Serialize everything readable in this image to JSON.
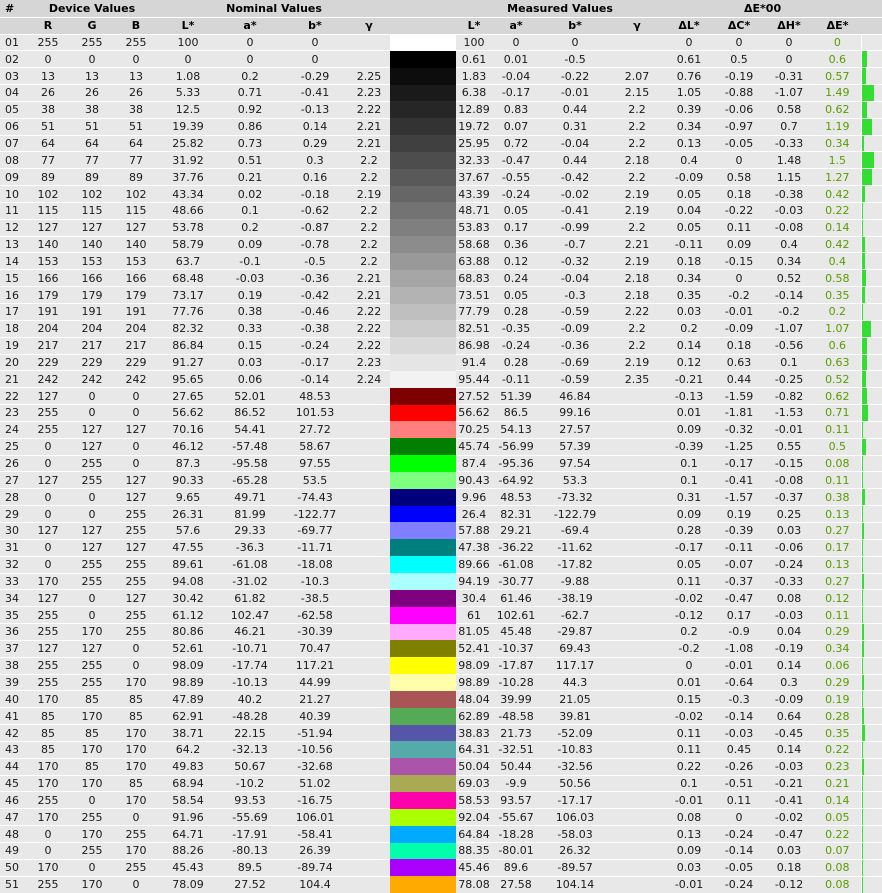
{
  "header": {
    "num": "#",
    "device": "Device Values",
    "nominal": "Nominal Values",
    "measured": "Measured Values",
    "de00": "ΔE*00"
  },
  "columns": {
    "r": "R",
    "g": "G",
    "b": "B",
    "l_star": "L*",
    "a_star": "a*",
    "b_star": "b*",
    "gamma": "γ",
    "d_l": "ΔL*",
    "d_c": "ΔC*",
    "d_h": "ΔH*",
    "d_e": "ΔE*"
  },
  "colors": {
    "header_bg": "#d6d6d6",
    "row_bg": "#e8e8e8",
    "separator": "#ffffff",
    "text": "#1a1a1a",
    "delta_e_text": "#5a9b00",
    "bar_green": "#33dd33"
  },
  "rows": [
    {
      "n": "01",
      "rgb": [
        255,
        255,
        255
      ],
      "nominal": [
        "100",
        "0",
        "0",
        ""
      ],
      "measured": [
        "100",
        "0",
        "0",
        ""
      ],
      "delta": [
        "0",
        "0",
        "0"
      ],
      "de": "0"
    },
    {
      "n": "02",
      "rgb": [
        0,
        0,
        0
      ],
      "nominal": [
        "0",
        "0",
        "0",
        ""
      ],
      "measured": [
        "0.61",
        "0.01",
        "-0.5",
        ""
      ],
      "delta": [
        "0.61",
        "0.5",
        "0"
      ],
      "de": "0.6"
    },
    {
      "n": "03",
      "rgb": [
        13,
        13,
        13
      ],
      "nominal": [
        "1.08",
        "0.2",
        "-0.29",
        "2.25"
      ],
      "measured": [
        "1.83",
        "-0.04",
        "-0.22",
        "2.07"
      ],
      "delta": [
        "0.76",
        "-0.19",
        "-0.31"
      ],
      "de": "0.57"
    },
    {
      "n": "04",
      "rgb": [
        26,
        26,
        26
      ],
      "nominal": [
        "5.33",
        "0.71",
        "-0.41",
        "2.23"
      ],
      "measured": [
        "6.38",
        "-0.17",
        "-0.01",
        "2.15"
      ],
      "delta": [
        "1.05",
        "-0.88",
        "-1.07"
      ],
      "de": "1.49"
    },
    {
      "n": "05",
      "rgb": [
        38,
        38,
        38
      ],
      "nominal": [
        "12.5",
        "0.92",
        "-0.13",
        "2.22"
      ],
      "measured": [
        "12.89",
        "0.83",
        "0.44",
        "2.2"
      ],
      "delta": [
        "0.39",
        "-0.06",
        "0.58"
      ],
      "de": "0.62"
    },
    {
      "n": "06",
      "rgb": [
        51,
        51,
        51
      ],
      "nominal": [
        "19.39",
        "0.86",
        "0.14",
        "2.21"
      ],
      "measured": [
        "19.72",
        "0.07",
        "0.31",
        "2.2"
      ],
      "delta": [
        "0.34",
        "-0.97",
        "0.7"
      ],
      "de": "1.19"
    },
    {
      "n": "07",
      "rgb": [
        64,
        64,
        64
      ],
      "nominal": [
        "25.82",
        "0.73",
        "0.29",
        "2.21"
      ],
      "measured": [
        "25.95",
        "0.72",
        "-0.04",
        "2.2"
      ],
      "delta": [
        "0.13",
        "-0.05",
        "-0.33"
      ],
      "de": "0.34"
    },
    {
      "n": "08",
      "rgb": [
        77,
        77,
        77
      ],
      "nominal": [
        "31.92",
        "0.51",
        "0.3",
        "2.2"
      ],
      "measured": [
        "32.33",
        "-0.47",
        "0.44",
        "2.18"
      ],
      "delta": [
        "0.4",
        "0",
        "1.48"
      ],
      "de": "1.5"
    },
    {
      "n": "09",
      "rgb": [
        89,
        89,
        89
      ],
      "nominal": [
        "37.76",
        "0.21",
        "0.16",
        "2.2"
      ],
      "measured": [
        "37.67",
        "-0.55",
        "-0.42",
        "2.2"
      ],
      "delta": [
        "-0.09",
        "0.58",
        "1.15"
      ],
      "de": "1.27"
    },
    {
      "n": "10",
      "rgb": [
        102,
        102,
        102
      ],
      "nominal": [
        "43.34",
        "0.02",
        "-0.18",
        "2.19"
      ],
      "measured": [
        "43.39",
        "-0.24",
        "-0.02",
        "2.19"
      ],
      "delta": [
        "0.05",
        "0.18",
        "-0.38"
      ],
      "de": "0.42"
    },
    {
      "n": "11",
      "rgb": [
        115,
        115,
        115
      ],
      "nominal": [
        "48.66",
        "0.1",
        "-0.62",
        "2.2"
      ],
      "measured": [
        "48.71",
        "0.05",
        "-0.41",
        "2.19"
      ],
      "delta": [
        "0.04",
        "-0.22",
        "-0.03"
      ],
      "de": "0.22"
    },
    {
      "n": "12",
      "rgb": [
        127,
        127,
        127
      ],
      "nominal": [
        "53.78",
        "0.2",
        "-0.87",
        "2.2"
      ],
      "measured": [
        "53.83",
        "0.17",
        "-0.99",
        "2.2"
      ],
      "delta": [
        "0.05",
        "0.11",
        "-0.08"
      ],
      "de": "0.14"
    },
    {
      "n": "13",
      "rgb": [
        140,
        140,
        140
      ],
      "nominal": [
        "58.79",
        "0.09",
        "-0.78",
        "2.2"
      ],
      "measured": [
        "58.68",
        "0.36",
        "-0.7",
        "2.21"
      ],
      "delta": [
        "-0.11",
        "0.09",
        "0.4"
      ],
      "de": "0.42"
    },
    {
      "n": "14",
      "rgb": [
        153,
        153,
        153
      ],
      "nominal": [
        "63.7",
        "-0.1",
        "-0.5",
        "2.2"
      ],
      "measured": [
        "63.88",
        "0.12",
        "-0.32",
        "2.19"
      ],
      "delta": [
        "0.18",
        "-0.15",
        "0.34"
      ],
      "de": "0.4"
    },
    {
      "n": "15",
      "rgb": [
        166,
        166,
        166
      ],
      "nominal": [
        "68.48",
        "-0.03",
        "-0.36",
        "2.21"
      ],
      "measured": [
        "68.83",
        "0.24",
        "-0.04",
        "2.18"
      ],
      "delta": [
        "0.34",
        "0",
        "0.52"
      ],
      "de": "0.58"
    },
    {
      "n": "16",
      "rgb": [
        179,
        179,
        179
      ],
      "nominal": [
        "73.17",
        "0.19",
        "-0.42",
        "2.21"
      ],
      "measured": [
        "73.51",
        "0.05",
        "-0.3",
        "2.18"
      ],
      "delta": [
        "0.35",
        "-0.2",
        "-0.14"
      ],
      "de": "0.35"
    },
    {
      "n": "17",
      "rgb": [
        191,
        191,
        191
      ],
      "nominal": [
        "77.76",
        "0.38",
        "-0.46",
        "2.22"
      ],
      "measured": [
        "77.79",
        "0.28",
        "-0.59",
        "2.22"
      ],
      "delta": [
        "0.03",
        "-0.01",
        "-0.2"
      ],
      "de": "0.2"
    },
    {
      "n": "18",
      "rgb": [
        204,
        204,
        204
      ],
      "nominal": [
        "82.32",
        "0.33",
        "-0.38",
        "2.22"
      ],
      "measured": [
        "82.51",
        "-0.35",
        "-0.09",
        "2.2"
      ],
      "delta": [
        "0.2",
        "-0.09",
        "-1.07"
      ],
      "de": "1.07"
    },
    {
      "n": "19",
      "rgb": [
        217,
        217,
        217
      ],
      "nominal": [
        "86.84",
        "0.15",
        "-0.24",
        "2.22"
      ],
      "measured": [
        "86.98",
        "-0.24",
        "-0.36",
        "2.2"
      ],
      "delta": [
        "0.14",
        "0.18",
        "-0.56"
      ],
      "de": "0.6"
    },
    {
      "n": "20",
      "rgb": [
        229,
        229,
        229
      ],
      "nominal": [
        "91.27",
        "0.03",
        "-0.17",
        "2.23"
      ],
      "measured": [
        "91.4",
        "0.28",
        "-0.69",
        "2.19"
      ],
      "delta": [
        "0.12",
        "0.63",
        "0.1"
      ],
      "de": "0.63"
    },
    {
      "n": "21",
      "rgb": [
        242,
        242,
        242
      ],
      "nominal": [
        "95.65",
        "0.06",
        "-0.14",
        "2.24"
      ],
      "measured": [
        "95.44",
        "-0.11",
        "-0.59",
        "2.35"
      ],
      "delta": [
        "-0.21",
        "0.44",
        "-0.25"
      ],
      "de": "0.52"
    },
    {
      "n": "22",
      "rgb": [
        127,
        0,
        0
      ],
      "nominal": [
        "27.65",
        "52.01",
        "48.53",
        ""
      ],
      "measured": [
        "27.52",
        "51.39",
        "46.84",
        ""
      ],
      "delta": [
        "-0.13",
        "-1.59",
        "-0.82"
      ],
      "de": "0.62"
    },
    {
      "n": "23",
      "rgb": [
        255,
        0,
        0
      ],
      "nominal": [
        "56.62",
        "86.52",
        "101.53",
        ""
      ],
      "measured": [
        "56.62",
        "86.5",
        "99.16",
        ""
      ],
      "delta": [
        "0.01",
        "-1.81",
        "-1.53"
      ],
      "de": "0.71"
    },
    {
      "n": "24",
      "rgb": [
        255,
        127,
        127
      ],
      "nominal": [
        "70.16",
        "54.41",
        "27.72",
        ""
      ],
      "measured": [
        "70.25",
        "54.13",
        "27.57",
        ""
      ],
      "delta": [
        "0.09",
        "-0.32",
        "-0.01"
      ],
      "de": "0.11"
    },
    {
      "n": "25",
      "rgb": [
        0,
        127,
        0
      ],
      "nominal": [
        "46.12",
        "-57.48",
        "58.67",
        ""
      ],
      "measured": [
        "45.74",
        "-56.99",
        "57.39",
        ""
      ],
      "delta": [
        "-0.39",
        "-1.25",
        "0.55"
      ],
      "de": "0.5"
    },
    {
      "n": "26",
      "rgb": [
        0,
        255,
        0
      ],
      "nominal": [
        "87.3",
        "-95.58",
        "97.55",
        ""
      ],
      "measured": [
        "87.4",
        "-95.36",
        "97.54",
        ""
      ],
      "delta": [
        "0.1",
        "-0.17",
        "-0.15"
      ],
      "de": "0.08"
    },
    {
      "n": "27",
      "rgb": [
        127,
        255,
        127
      ],
      "nominal": [
        "90.33",
        "-65.28",
        "53.5",
        ""
      ],
      "measured": [
        "90.43",
        "-64.92",
        "53.3",
        ""
      ],
      "delta": [
        "0.1",
        "-0.41",
        "-0.08"
      ],
      "de": "0.11"
    },
    {
      "n": "28",
      "rgb": [
        0,
        0,
        127
      ],
      "nominal": [
        "9.65",
        "49.71",
        "-74.43",
        ""
      ],
      "measured": [
        "9.96",
        "48.53",
        "-73.32",
        ""
      ],
      "delta": [
        "0.31",
        "-1.57",
        "-0.37"
      ],
      "de": "0.38"
    },
    {
      "n": "29",
      "rgb": [
        0,
        0,
        255
      ],
      "nominal": [
        "26.31",
        "81.99",
        "-122.77",
        ""
      ],
      "measured": [
        "26.4",
        "82.31",
        "-122.79",
        ""
      ],
      "delta": [
        "0.09",
        "0.19",
        "0.25"
      ],
      "de": "0.13"
    },
    {
      "n": "30",
      "rgb": [
        127,
        127,
        255
      ],
      "nominal": [
        "57.6",
        "29.33",
        "-69.77",
        ""
      ],
      "measured": [
        "57.88",
        "29.21",
        "-69.4",
        ""
      ],
      "delta": [
        "0.28",
        "-0.39",
        "0.03"
      ],
      "de": "0.27"
    },
    {
      "n": "31",
      "rgb": [
        0,
        127,
        127
      ],
      "nominal": [
        "47.55",
        "-36.3",
        "-11.71",
        ""
      ],
      "measured": [
        "47.38",
        "-36.22",
        "-11.62",
        ""
      ],
      "delta": [
        "-0.17",
        "-0.11",
        "-0.06"
      ],
      "de": "0.17"
    },
    {
      "n": "32",
      "rgb": [
        0,
        255,
        255
      ],
      "nominal": [
        "89.61",
        "-61.08",
        "-18.08",
        ""
      ],
      "measured": [
        "89.66",
        "-61.08",
        "-17.82",
        ""
      ],
      "delta": [
        "0.05",
        "-0.07",
        "-0.24"
      ],
      "de": "0.13"
    },
    {
      "n": "33",
      "rgb": [
        170,
        255,
        255
      ],
      "nominal": [
        "94.08",
        "-31.02",
        "-10.3",
        ""
      ],
      "measured": [
        "94.19",
        "-30.77",
        "-9.88",
        ""
      ],
      "delta": [
        "0.11",
        "-0.37",
        "-0.33"
      ],
      "de": "0.27"
    },
    {
      "n": "34",
      "rgb": [
        127,
        0,
        127
      ],
      "nominal": [
        "30.42",
        "61.82",
        "-38.5",
        ""
      ],
      "measured": [
        "30.4",
        "61.46",
        "-38.19",
        ""
      ],
      "delta": [
        "-0.02",
        "-0.47",
        "0.08"
      ],
      "de": "0.12"
    },
    {
      "n": "35",
      "rgb": [
        255,
        0,
        255
      ],
      "nominal": [
        "61.12",
        "102.47",
        "-62.58",
        ""
      ],
      "measured": [
        "61",
        "102.61",
        "-62.7",
        ""
      ],
      "delta": [
        "-0.12",
        "0.17",
        "-0.03"
      ],
      "de": "0.11"
    },
    {
      "n": "36",
      "rgb": [
        255,
        170,
        255
      ],
      "nominal": [
        "80.86",
        "46.21",
        "-30.39",
        ""
      ],
      "measured": [
        "81.05",
        "45.48",
        "-29.87",
        ""
      ],
      "delta": [
        "0.2",
        "-0.9",
        "0.04"
      ],
      "de": "0.29"
    },
    {
      "n": "37",
      "rgb": [
        127,
        127,
        0
      ],
      "nominal": [
        "52.61",
        "-10.71",
        "70.47",
        ""
      ],
      "measured": [
        "52.41",
        "-10.37",
        "69.43",
        ""
      ],
      "delta": [
        "-0.2",
        "-1.08",
        "-0.19"
      ],
      "de": "0.34"
    },
    {
      "n": "38",
      "rgb": [
        255,
        255,
        0
      ],
      "nominal": [
        "98.09",
        "-17.74",
        "117.21",
        ""
      ],
      "measured": [
        "98.09",
        "-17.87",
        "117.17",
        ""
      ],
      "delta": [
        "0",
        "-0.01",
        "0.14"
      ],
      "de": "0.06"
    },
    {
      "n": "39",
      "rgb": [
        255,
        255,
        170
      ],
      "nominal": [
        "98.89",
        "-10.13",
        "44.99",
        ""
      ],
      "measured": [
        "98.89",
        "-10.28",
        "44.3",
        ""
      ],
      "delta": [
        "0.01",
        "-0.64",
        "0.3"
      ],
      "de": "0.29"
    },
    {
      "n": "40",
      "rgb": [
        170,
        85,
        85
      ],
      "nominal": [
        "47.89",
        "40.2",
        "21.27",
        ""
      ],
      "measured": [
        "48.04",
        "39.99",
        "21.05",
        ""
      ],
      "delta": [
        "0.15",
        "-0.3",
        "-0.09"
      ],
      "de": "0.19"
    },
    {
      "n": "41",
      "rgb": [
        85,
        170,
        85
      ],
      "nominal": [
        "62.91",
        "-48.28",
        "40.39",
        ""
      ],
      "measured": [
        "62.89",
        "-48.58",
        "39.81",
        ""
      ],
      "delta": [
        "-0.02",
        "-0.14",
        "0.64"
      ],
      "de": "0.28"
    },
    {
      "n": "42",
      "rgb": [
        85,
        85,
        170
      ],
      "nominal": [
        "38.71",
        "22.15",
        "-51.94",
        ""
      ],
      "measured": [
        "38.83",
        "21.73",
        "-52.09",
        ""
      ],
      "delta": [
        "0.11",
        "-0.03",
        "-0.45"
      ],
      "de": "0.35"
    },
    {
      "n": "43",
      "rgb": [
        85,
        170,
        170
      ],
      "nominal": [
        "64.2",
        "-32.13",
        "-10.56",
        ""
      ],
      "measured": [
        "64.31",
        "-32.51",
        "-10.83",
        ""
      ],
      "delta": [
        "0.11",
        "0.45",
        "0.14"
      ],
      "de": "0.22"
    },
    {
      "n": "44",
      "rgb": [
        170,
        85,
        170
      ],
      "nominal": [
        "49.83",
        "50.67",
        "-32.68",
        ""
      ],
      "measured": [
        "50.04",
        "50.44",
        "-32.56",
        ""
      ],
      "delta": [
        "0.22",
        "-0.26",
        "-0.03"
      ],
      "de": "0.23"
    },
    {
      "n": "45",
      "rgb": [
        170,
        170,
        85
      ],
      "nominal": [
        "68.94",
        "-10.2",
        "51.02",
        ""
      ],
      "measured": [
        "69.03",
        "-9.9",
        "50.56",
        ""
      ],
      "delta": [
        "0.1",
        "-0.51",
        "-0.21"
      ],
      "de": "0.21"
    },
    {
      "n": "46",
      "rgb": [
        255,
        0,
        170
      ],
      "nominal": [
        "58.54",
        "93.53",
        "-16.75",
        ""
      ],
      "measured": [
        "58.53",
        "93.57",
        "-17.17",
        ""
      ],
      "delta": [
        "-0.01",
        "0.11",
        "-0.41"
      ],
      "de": "0.14"
    },
    {
      "n": "47",
      "rgb": [
        170,
        255,
        0
      ],
      "nominal": [
        "91.96",
        "-55.69",
        "106.01",
        ""
      ],
      "measured": [
        "92.04",
        "-55.67",
        "106.03",
        ""
      ],
      "delta": [
        "0.08",
        "0",
        "-0.02"
      ],
      "de": "0.05"
    },
    {
      "n": "48",
      "rgb": [
        0,
        170,
        255
      ],
      "nominal": [
        "64.71",
        "-17.91",
        "-58.41",
        ""
      ],
      "measured": [
        "64.84",
        "-18.28",
        "-58.03",
        ""
      ],
      "delta": [
        "0.13",
        "-0.24",
        "-0.47"
      ],
      "de": "0.22"
    },
    {
      "n": "49",
      "rgb": [
        0,
        255,
        170
      ],
      "nominal": [
        "88.26",
        "-80.13",
        "26.39",
        ""
      ],
      "measured": [
        "88.35",
        "-80.01",
        "26.32",
        ""
      ],
      "delta": [
        "0.09",
        "-0.14",
        "0.03"
      ],
      "de": "0.07"
    },
    {
      "n": "50",
      "rgb": [
        170,
        0,
        255
      ],
      "nominal": [
        "45.43",
        "89.5",
        "-89.74",
        ""
      ],
      "measured": [
        "45.46",
        "89.6",
        "-89.57",
        ""
      ],
      "delta": [
        "0.03",
        "-0.05",
        "0.18"
      ],
      "de": "0.08"
    },
    {
      "n": "51",
      "rgb": [
        255,
        170,
        0
      ],
      "nominal": [
        "78.09",
        "27.52",
        "104.4",
        ""
      ],
      "measured": [
        "78.08",
        "27.58",
        "104.14",
        ""
      ],
      "delta": [
        "-0.01",
        "-0.24",
        "-0.12"
      ],
      "de": "0.08"
    }
  ]
}
